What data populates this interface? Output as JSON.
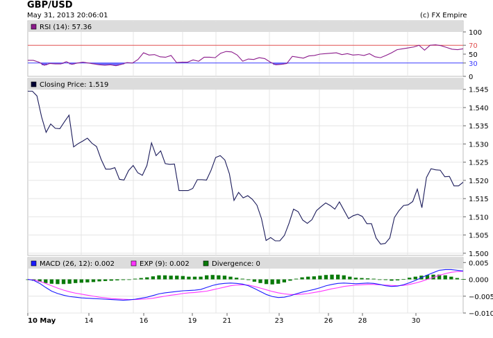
{
  "header": {
    "symbol": "GBP/USD",
    "timestamp": "May 31, 2013 20:06:01",
    "credit": "(c) FX Empire"
  },
  "colors": {
    "price_line": "#1a1a5a",
    "rsi_line": "#8b1a8b",
    "rsi_fill": "#5555ff",
    "rsi_upper": "#e05050",
    "rsi_lower": "#3a3aff",
    "macd_line": "#1a1aff",
    "signal_line": "#ff33ff",
    "divergence": "#0a7a0a",
    "panel_header_bg": "#dcdcdc",
    "grid": "#e4e4e4"
  },
  "chart_data": [
    {
      "type": "line",
      "panel": "rsi",
      "legend": "RSI (14): 57.36",
      "legend_color": "#8b1a8b",
      "y_ticks": [
        100,
        70,
        50,
        30,
        0
      ],
      "ylim": [
        0,
        100
      ],
      "thresholds": [
        70,
        30
      ],
      "values": [
        36,
        36,
        32,
        25,
        29,
        28,
        28,
        33,
        27,
        30,
        32,
        30,
        28,
        26,
        25,
        26,
        24,
        27,
        31,
        30,
        38,
        53,
        48,
        49,
        44,
        43,
        47,
        31,
        32,
        32,
        37,
        34,
        43,
        43,
        42,
        52,
        56,
        55,
        48,
        34,
        39,
        38,
        42,
        40,
        32,
        26,
        27,
        29,
        45,
        43,
        41,
        46,
        47,
        50,
        51,
        52,
        53,
        49,
        51,
        48,
        49,
        47,
        51,
        44,
        42,
        47,
        53,
        60,
        62,
        64,
        66,
        70,
        59,
        70,
        71,
        69,
        65,
        61,
        60,
        62
      ]
    },
    {
      "type": "line",
      "panel": "price",
      "legend": "Closing Price: 1.519",
      "legend_color": "#000033",
      "y_ticks": [
        1.545,
        1.54,
        1.535,
        1.53,
        1.525,
        1.52,
        1.515,
        1.51,
        1.505,
        1.5
      ],
      "y_tick_labels": [
        "1.545",
        "1.540",
        "1.535",
        "1.530",
        "1.525",
        "1.520",
        "1.515",
        "1.510",
        "1.505",
        "1.500"
      ],
      "ylim": [
        1.4994,
        1.548
      ],
      "values": [
        1.5445,
        1.5445,
        1.5432,
        1.5375,
        1.5332,
        1.5355,
        1.5343,
        1.5342,
        1.5361,
        1.5379,
        1.5292,
        1.5301,
        1.5308,
        1.5316,
        1.5302,
        1.5293,
        1.5258,
        1.5231,
        1.5231,
        1.5235,
        1.5203,
        1.5201,
        1.5227,
        1.5241,
        1.5221,
        1.5214,
        1.5241,
        1.5303,
        1.5268,
        1.5281,
        1.5246,
        1.5244,
        1.5245,
        1.5172,
        1.5172,
        1.5172,
        1.5178,
        1.5202,
        1.5202,
        1.5201,
        1.5228,
        1.5263,
        1.5268,
        1.5256,
        1.5218,
        1.5145,
        1.5167,
        1.5152,
        1.5158,
        1.5148,
        1.5132,
        1.5095,
        1.5035,
        1.5043,
        1.5034,
        1.5034,
        1.5049,
        1.5082,
        1.5121,
        1.5114,
        1.5091,
        1.5082,
        1.5092,
        1.5117,
        1.5128,
        1.5138,
        1.5131,
        1.5121,
        1.5141,
        1.5118,
        1.5095,
        1.5103,
        1.5107,
        1.5101,
        1.5081,
        1.5081,
        1.5042,
        1.5025,
        1.5027,
        1.5042,
        1.5098,
        1.5117,
        1.5131,
        1.5133,
        1.5142,
        1.5176,
        1.5125,
        1.5208,
        1.5232,
        1.5229,
        1.5228,
        1.521,
        1.5211,
        1.5185,
        1.5185,
        1.5195
      ]
    },
    {
      "type": "line",
      "panel": "macd",
      "legend": [
        {
          "label": "MACD (26, 12): 0.002",
          "color": "#1a1aff"
        },
        {
          "label": "EXP (9): 0.002",
          "color": "#ff33ff"
        },
        {
          "label": "Divergence: 0",
          "color": "#0a7a0a"
        }
      ],
      "y_ticks": [
        0.005,
        0.0,
        -0.005,
        -0.01
      ],
      "y_tick_labels": [
        "0.005",
        "0.000",
        "−0.005",
        "−0.010"
      ],
      "ylim": [
        -0.01,
        0.0065
      ],
      "x_tick_labels": [
        "10 May",
        "14",
        "16",
        "19",
        "21",
        "23",
        "26",
        "28",
        "30"
      ],
      "macd": [
        0,
        -0.0003,
        -0.0012,
        -0.0024,
        -0.0035,
        -0.0042,
        -0.0047,
        -0.0051,
        -0.0053,
        -0.0055,
        -0.0056,
        -0.0057,
        -0.0058,
        -0.0059,
        -0.006,
        -0.0061,
        -0.0062,
        -0.0061,
        -0.0059,
        -0.0056,
        -0.0053,
        -0.0048,
        -0.0043,
        -0.004,
        -0.0038,
        -0.0036,
        -0.0034,
        -0.0033,
        -0.0032,
        -0.003,
        -0.0024,
        -0.0018,
        -0.0014,
        -0.0012,
        -0.0011,
        -0.0012,
        -0.0014,
        -0.0019,
        -0.0027,
        -0.0036,
        -0.0045,
        -0.0051,
        -0.0054,
        -0.0053,
        -0.0049,
        -0.0043,
        -0.0038,
        -0.0034,
        -0.003,
        -0.0025,
        -0.0019,
        -0.0015,
        -0.0012,
        -0.0011,
        -0.0012,
        -0.0013,
        -0.0012,
        -0.0011,
        -0.0012,
        -0.0015,
        -0.0019,
        -0.0021,
        -0.002,
        -0.0016,
        -0.001,
        -0.0003,
        0.0005,
        0.0013,
        0.002,
        0.0027,
        0.0029,
        0.0029,
        0.0027,
        0.0025
      ],
      "signal": [
        0,
        -0.0002,
        -0.0006,
        -0.0012,
        -0.0019,
        -0.0026,
        -0.0032,
        -0.0037,
        -0.0041,
        -0.0044,
        -0.0047,
        -0.005,
        -0.0053,
        -0.0055,
        -0.0057,
        -0.0058,
        -0.0059,
        -0.006,
        -0.006,
        -0.0059,
        -0.0058,
        -0.0056,
        -0.0053,
        -0.005,
        -0.0047,
        -0.0045,
        -0.0042,
        -0.004,
        -0.0039,
        -0.0037,
        -0.0035,
        -0.0031,
        -0.0027,
        -0.0023,
        -0.0019,
        -0.0017,
        -0.0016,
        -0.0017,
        -0.0021,
        -0.0026,
        -0.0031,
        -0.0036,
        -0.004,
        -0.0043,
        -0.0045,
        -0.0045,
        -0.0044,
        -0.0042,
        -0.0039,
        -0.0036,
        -0.0032,
        -0.0028,
        -0.0025,
        -0.0021,
        -0.0019,
        -0.0017,
        -0.0016,
        -0.0015,
        -0.0015,
        -0.0016,
        -0.0017,
        -0.0018,
        -0.0019,
        -0.0018,
        -0.0015,
        -0.0011,
        -0.0006,
        0,
        0.0006,
        0.0012,
        0.0017,
        0.0021,
        0.0023,
        0.0024
      ],
      "divergence": [
        0,
        -0.0004,
        -0.0007,
        -0.0011,
        -0.0013,
        -0.0014,
        -0.0014,
        -0.0013,
        -0.0011,
        -0.001,
        -0.0009,
        -0.0008,
        -0.0006,
        -0.0005,
        -0.0004,
        -0.0003,
        -0.0002,
        0,
        0.0002,
        0.0004,
        0.0006,
        0.0009,
        0.0012,
        0.0012,
        0.0011,
        0.0011,
        0.001,
        0.0008,
        0.0008,
        0.0008,
        0.0012,
        0.0013,
        0.0012,
        0.0011,
        0.0008,
        0.0005,
        0.0002,
        -0.0002,
        -0.0007,
        -0.0011,
        -0.0014,
        -0.0015,
        -0.0013,
        -0.0009,
        -0.0004,
        0.0002,
        0.0006,
        0.0008,
        0.0009,
        0.0011,
        0.0013,
        0.0014,
        0.0014,
        0.0012,
        0.0008,
        0.0005,
        0.0004,
        0.0003,
        0.0002,
        0,
        -0.0002,
        -0.0004,
        -0.0003,
        0.0001,
        0.0005,
        0.0008,
        0.0011,
        0.0013,
        0.0014,
        0.0014,
        0.0012,
        0.0008,
        0.0004,
        0.0001
      ]
    }
  ]
}
